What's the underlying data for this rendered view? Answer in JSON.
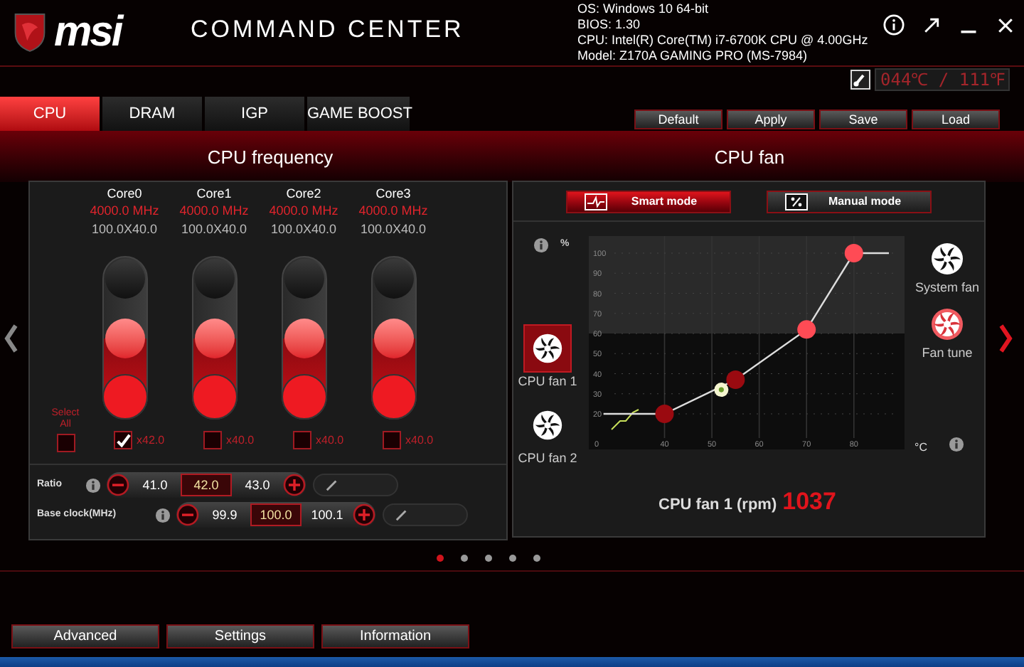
{
  "header": {
    "logo": "msi",
    "app_title": "COMMAND CENTER",
    "system_info": [
      "OS: Windows 10 64-bit",
      "BIOS: 1.30",
      "CPU: Intel(R) Core(TM) i7-6700K CPU @ 4.00GHz",
      "Model: Z170A GAMING PRO (MS-7984)"
    ],
    "temperature": "044℃ / 111℉"
  },
  "tabs": [
    {
      "label": "CPU",
      "selected": true
    },
    {
      "label": "DRAM",
      "selected": false
    },
    {
      "label": "IGP",
      "selected": false
    },
    {
      "label": "GAME BOOST",
      "selected": false
    }
  ],
  "actions": [
    "Default",
    "Apply",
    "Save",
    "Load"
  ],
  "cpu_frequency": {
    "title": "CPU frequency",
    "cores": [
      {
        "name": "Core0",
        "frequency": "4000.0 MHz",
        "multiplier": "100.0X40.0",
        "level": 0.5,
        "checked": true,
        "ratio": "x42.0"
      },
      {
        "name": "Core1",
        "frequency": "4000.0 MHz",
        "multiplier": "100.0X40.0",
        "level": 0.5,
        "checked": false,
        "ratio": "x40.0"
      },
      {
        "name": "Core2",
        "frequency": "4000.0 MHz",
        "multiplier": "100.0X40.0",
        "level": 0.5,
        "checked": false,
        "ratio": "x40.0"
      },
      {
        "name": "Core3",
        "frequency": "4000.0 MHz",
        "multiplier": "100.0X40.0",
        "level": 0.5,
        "checked": false,
        "ratio": "x40.0"
      }
    ],
    "select_all": {
      "label": "Select All",
      "checked": false
    },
    "controls": [
      {
        "label": "Ratio",
        "values": [
          {
            "text": "41.0",
            "selected": false
          },
          {
            "text": "42.0",
            "selected": true
          },
          {
            "text": "43.0",
            "selected": false
          }
        ]
      },
      {
        "label": "Base clock(MHz)",
        "values": [
          {
            "text": "99.9",
            "selected": false
          },
          {
            "text": "100.0",
            "selected": true
          },
          {
            "text": "100.1",
            "selected": false
          }
        ]
      }
    ]
  },
  "cpu_fan": {
    "title": "CPU fan",
    "modes": [
      {
        "label": "Smart mode",
        "kind": "smart",
        "selected": true
      },
      {
        "label": "Manual mode",
        "kind": "manual",
        "selected": false
      }
    ],
    "fans": [
      {
        "label": "CPU fan 1",
        "selected": true
      },
      {
        "label": "CPU fan 2",
        "selected": false
      }
    ],
    "side_buttons": [
      {
        "label": "System fan",
        "active": false
      },
      {
        "label": "Fan tune",
        "active": true
      }
    ],
    "chart_data": {
      "type": "line",
      "ylabel": "%",
      "xlabel": "°C",
      "x": [
        27.1,
        40,
        55,
        70,
        80,
        87.4
      ],
      "series": [
        {
          "color": "#dddddd",
          "marker": "circle",
          "values": [
            20,
            20,
            37,
            62,
            100,
            100
          ]
        }
      ],
      "grid": true,
      "bands": [
        {
          "axis": "y",
          "from": 60,
          "to": 108.5,
          "color": "#2a2a2a"
        }
      ],
      "xlim": [
        24,
        90.7
      ],
      "ylim": [
        2.3,
        108.5
      ],
      "xticks": [
        40,
        50,
        60,
        70,
        80
      ],
      "yticks": [
        20,
        30,
        40,
        50,
        60,
        70,
        80,
        90,
        100
      ]
    },
    "x_axis_origin_label": "0",
    "reading": {
      "label": "CPU fan 1 (rpm)",
      "value": "1037"
    }
  },
  "pager": [
    {
      "selected": true
    },
    {
      "selected": false
    },
    {
      "selected": false
    },
    {
      "selected": false
    },
    {
      "selected": false
    }
  ],
  "bottom_buttons": [
    "Advanced",
    "Settings",
    "Information"
  ]
}
